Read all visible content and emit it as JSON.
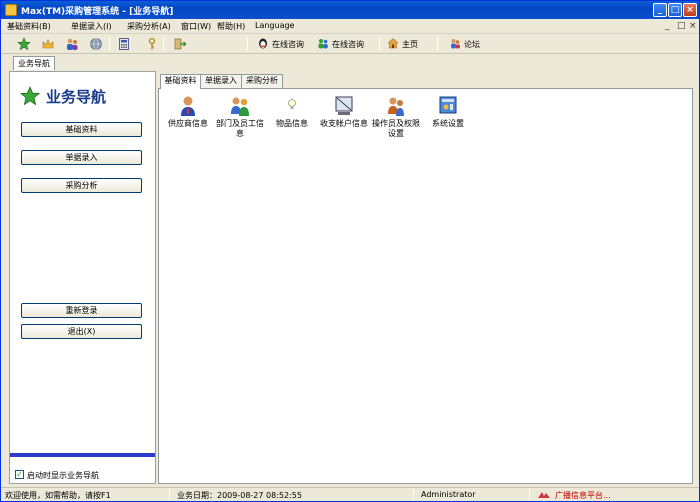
{
  "window": {
    "title": "Max(TM)采购管理系统 - [业务导航]",
    "minimize_glyph": "_",
    "maximize_glyph": "□",
    "close_glyph": "×",
    "mdi_min_glyph": "_",
    "mdi_restore_glyph": "□",
    "mdi_close_glyph": "×"
  },
  "menubar": {
    "items": [
      {
        "label": "基础资料(B)"
      },
      {
        "label": "单据录入(I)"
      },
      {
        "label": "采购分析(A)"
      },
      {
        "label": "窗口(W)"
      },
      {
        "label": "帮助(H)"
      },
      {
        "label": "Language"
      }
    ]
  },
  "toolbar": {
    "icons": [
      "star-icon",
      "crown-icon",
      "users-icon",
      "globe-icon",
      "calculator-icon",
      "key-icon",
      "exit-icon"
    ],
    "links": [
      {
        "label": "在线咨询",
        "icon": "qq-penguin-icon"
      },
      {
        "label": "在线咨询",
        "icon": "msn-icon"
      },
      {
        "label": "主页",
        "icon": "home-icon"
      },
      {
        "label": "论坛",
        "icon": "forum-icon"
      }
    ]
  },
  "doc_tab": {
    "label": "业务导航"
  },
  "nav": {
    "title": "业务导航",
    "buttons": [
      {
        "label": "基础资料"
      },
      {
        "label": "单据录入"
      },
      {
        "label": "采购分析"
      }
    ],
    "relogin_label": "重新登录",
    "exit_label": "退出(X)",
    "startup_checkbox": {
      "label": "启动时显示业务导航",
      "checked": true,
      "check_glyph": "✓"
    }
  },
  "content": {
    "tabs": [
      {
        "label": "基础资料",
        "active": true
      },
      {
        "label": "单据录入",
        "active": false
      },
      {
        "label": "采购分析",
        "active": false
      }
    ],
    "items": [
      {
        "label": "供应商信息",
        "icon": "supplier-icon"
      },
      {
        "label": "部门及员工信息",
        "icon": "department-staff-icon"
      },
      {
        "label": "物品信息",
        "icon": "lightbulb-icon"
      },
      {
        "label": "收支帐户信息",
        "icon": "account-icon"
      },
      {
        "label": "操作员及权限设置",
        "icon": "operator-permission-icon"
      },
      {
        "label": "系统设置",
        "icon": "system-settings-icon"
      }
    ]
  },
  "statusbar": {
    "welcome": "欢迎使用，如需帮助，请按F1",
    "date": "业务日期：2009-08-27 08:52:55",
    "user": "Administrator",
    "ad": "广播信息平台..."
  },
  "colors": {
    "titlebar": "#0447c4",
    "nav_title": "#1a3c8a",
    "blue_strip": "#2a3cd0",
    "ad_text": "#c00000"
  }
}
